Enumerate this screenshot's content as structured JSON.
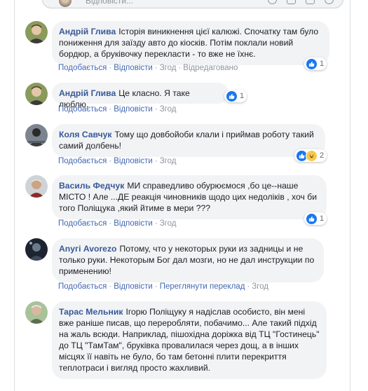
{
  "reply_box": {
    "placeholder": "Відповісти..."
  },
  "actions": {
    "like": "Подобається",
    "reply": "Відповісти",
    "translate": "Переглянути переклад",
    "edited": "Відредаговано"
  },
  "colors": {
    "link": "#385898",
    "action_link": "#4267b2",
    "meta_text": "#90949c",
    "bubble_bg": "#f2f3f5",
    "like_blue": "#1877f2"
  },
  "comments": [
    {
      "author": "Андрій Глива",
      "text": "Історія виникнення цієї калюжі. Спочатку там було пониження для заїзду авто до кіосків. Потім поклали новий бордюр, а бруківочку перекласти - то вже не їхнє.",
      "time": "Згод",
      "edited": true,
      "reactions": [
        "like-icon"
      ],
      "reaction_count": "1"
    },
    {
      "author": "Андрій Глива",
      "text": "Це класно. Я таке люблю.",
      "time": "Згод",
      "reactions": [
        "like-icon"
      ],
      "reaction_count": "1"
    },
    {
      "author": "Коля Савчук",
      "text": "Тому що довбойоби клали і приймав роботу такий самий долбень!",
      "time": "Згод",
      "reactions": [
        "like-icon",
        "haha-icon"
      ],
      "reaction_count": "2"
    },
    {
      "author": "Василь Федчук",
      "text": "МИ справедливо обурюємося ,бо це--наше МІСТО ! Але ...ДЕ реакція чиновників щодо цих недоліків , хоч би того Поліщука ,який йтиме в мери ???",
      "time": "Згод",
      "reactions": [
        "like-icon"
      ],
      "reaction_count": "1"
    },
    {
      "author": "Anyгі Avorezo",
      "text": "Потому, что у некоторых руки из задницы и не только руки. Некоторым Бог дал мозги, но не дал инструкции по применению!",
      "time": "Згод",
      "translate": true
    },
    {
      "author": "Тарас Мельник",
      "text": "Ігорю Поліщуку я надіслав особисто, він мені вже раніше писав, що переробляти, побачимо... Але такий підхід на жаль всюди. Наприклад, пішохідна доріжка від ТЦ \"Гостинець\" до ТЦ \"ТамТам\", бруківка провалилася через дощ, а в інших місцях її навіть не було, бо там бетонні плити перекриття теплотраси і вигляд просто жахливий."
    }
  ]
}
